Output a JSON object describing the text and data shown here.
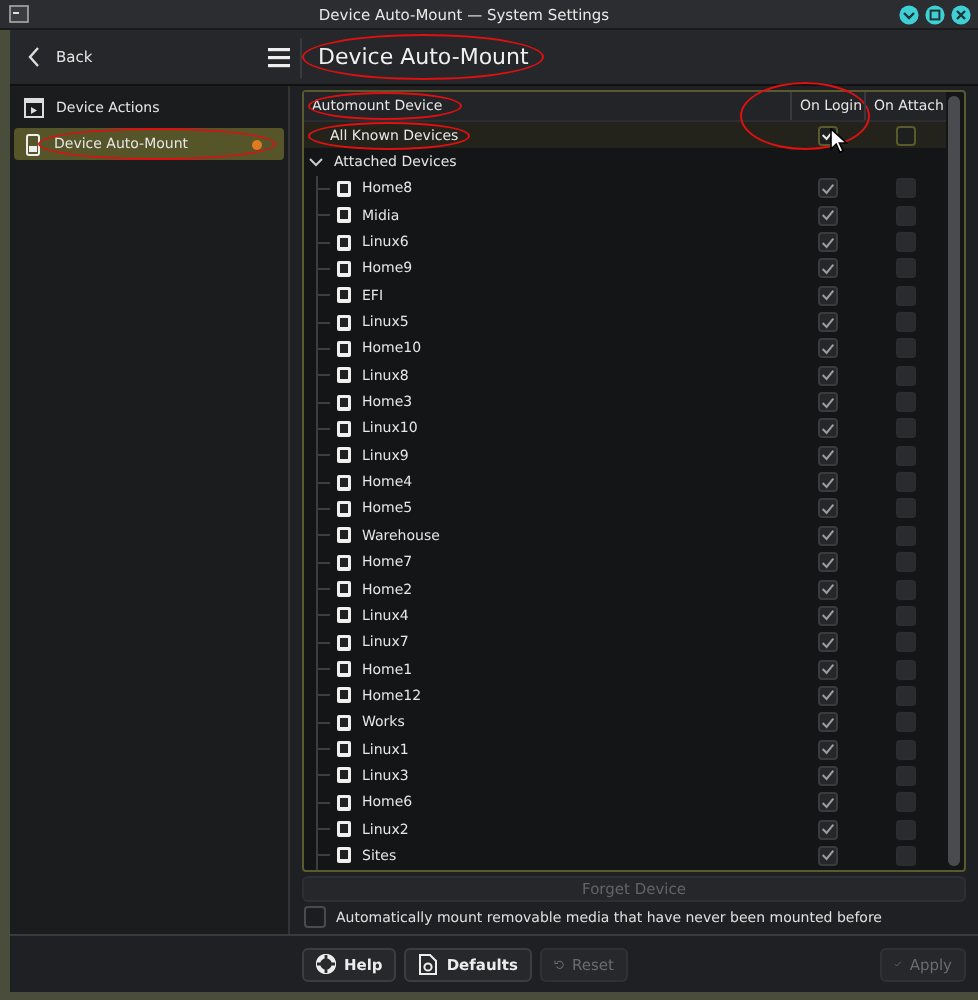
{
  "window": {
    "title": "Device Auto-Mount — System Settings"
  },
  "nav": {
    "back": "Back"
  },
  "page_title": {
    "text": "Device Auto-Mount",
    "circled": true
  },
  "sidebar": {
    "items": [
      {
        "label": "Device Actions",
        "kind": "actions",
        "selected": false
      },
      {
        "label": "Device Auto-Mount",
        "kind": "drive",
        "selected": true,
        "circled": true,
        "changed": true
      }
    ]
  },
  "table": {
    "columns": [
      {
        "label": "Automount Device",
        "circled": true
      },
      {
        "label": "On Login",
        "circled": true
      },
      {
        "label": "On Attach"
      }
    ],
    "rows": [
      {
        "kind": "all",
        "label": "All Known Devices",
        "selected": true,
        "circled": true,
        "on_login": true,
        "on_attach": false,
        "disabled": false
      },
      {
        "kind": "group",
        "label": "Attached Devices",
        "selected": false,
        "expanded": true,
        "children": [
          {
            "label": "Home8",
            "on_login": true,
            "on_attach": false,
            "disabled": true
          },
          {
            "label": "Midia",
            "on_login": true,
            "on_attach": false,
            "disabled": true
          },
          {
            "label": "Linux6",
            "on_login": true,
            "on_attach": false,
            "disabled": true
          },
          {
            "label": "Home9",
            "on_login": true,
            "on_attach": false,
            "disabled": true
          },
          {
            "label": "EFI",
            "on_login": true,
            "on_attach": false,
            "disabled": true
          },
          {
            "label": "Linux5",
            "on_login": true,
            "on_attach": false,
            "disabled": true
          },
          {
            "label": "Home10",
            "on_login": true,
            "on_attach": false,
            "disabled": true
          },
          {
            "label": "Linux8",
            "on_login": true,
            "on_attach": false,
            "disabled": true
          },
          {
            "label": "Home3",
            "on_login": true,
            "on_attach": false,
            "disabled": true
          },
          {
            "label": "Linux10",
            "on_login": true,
            "on_attach": false,
            "disabled": true
          },
          {
            "label": "Linux9",
            "on_login": true,
            "on_attach": false,
            "disabled": true
          },
          {
            "label": "Home4",
            "on_login": true,
            "on_attach": false,
            "disabled": true
          },
          {
            "label": "Home5",
            "on_login": true,
            "on_attach": false,
            "disabled": true
          },
          {
            "label": "Warehouse",
            "on_login": true,
            "on_attach": false,
            "disabled": true
          },
          {
            "label": "Home7",
            "on_login": true,
            "on_attach": false,
            "disabled": true
          },
          {
            "label": "Home2",
            "on_login": true,
            "on_attach": false,
            "disabled": true
          },
          {
            "label": "Linux4",
            "on_login": true,
            "on_attach": false,
            "disabled": true
          },
          {
            "label": "Linux7",
            "on_login": true,
            "on_attach": false,
            "disabled": true
          },
          {
            "label": "Home1",
            "on_login": true,
            "on_attach": false,
            "disabled": true
          },
          {
            "label": "Home12",
            "on_login": true,
            "on_attach": false,
            "disabled": true
          },
          {
            "label": "Works",
            "on_login": true,
            "on_attach": false,
            "disabled": true
          },
          {
            "label": "Linux1",
            "on_login": true,
            "on_attach": false,
            "disabled": true
          },
          {
            "label": "Linux3",
            "on_login": true,
            "on_attach": false,
            "disabled": true
          },
          {
            "label": "Home6",
            "on_login": true,
            "on_attach": false,
            "disabled": true
          },
          {
            "label": "Linux2",
            "on_login": true,
            "on_attach": false,
            "disabled": true
          },
          {
            "label": "Sites",
            "on_login": true,
            "on_attach": false,
            "disabled": true
          }
        ]
      }
    ]
  },
  "forget_button": {
    "label": "Forget Device",
    "disabled": true
  },
  "auto_mount_option": {
    "label": "Automatically mount removable media that have never been mounted before",
    "checked": false
  },
  "buttons": [
    {
      "kind": "help",
      "label": "Help",
      "disabled": false
    },
    {
      "kind": "defaults",
      "label": "Defaults",
      "disabled": false
    },
    {
      "kind": "reset",
      "label": "Reset",
      "disabled": true
    },
    {
      "kind": "apply",
      "label": "Apply",
      "disabled": true
    }
  ]
}
